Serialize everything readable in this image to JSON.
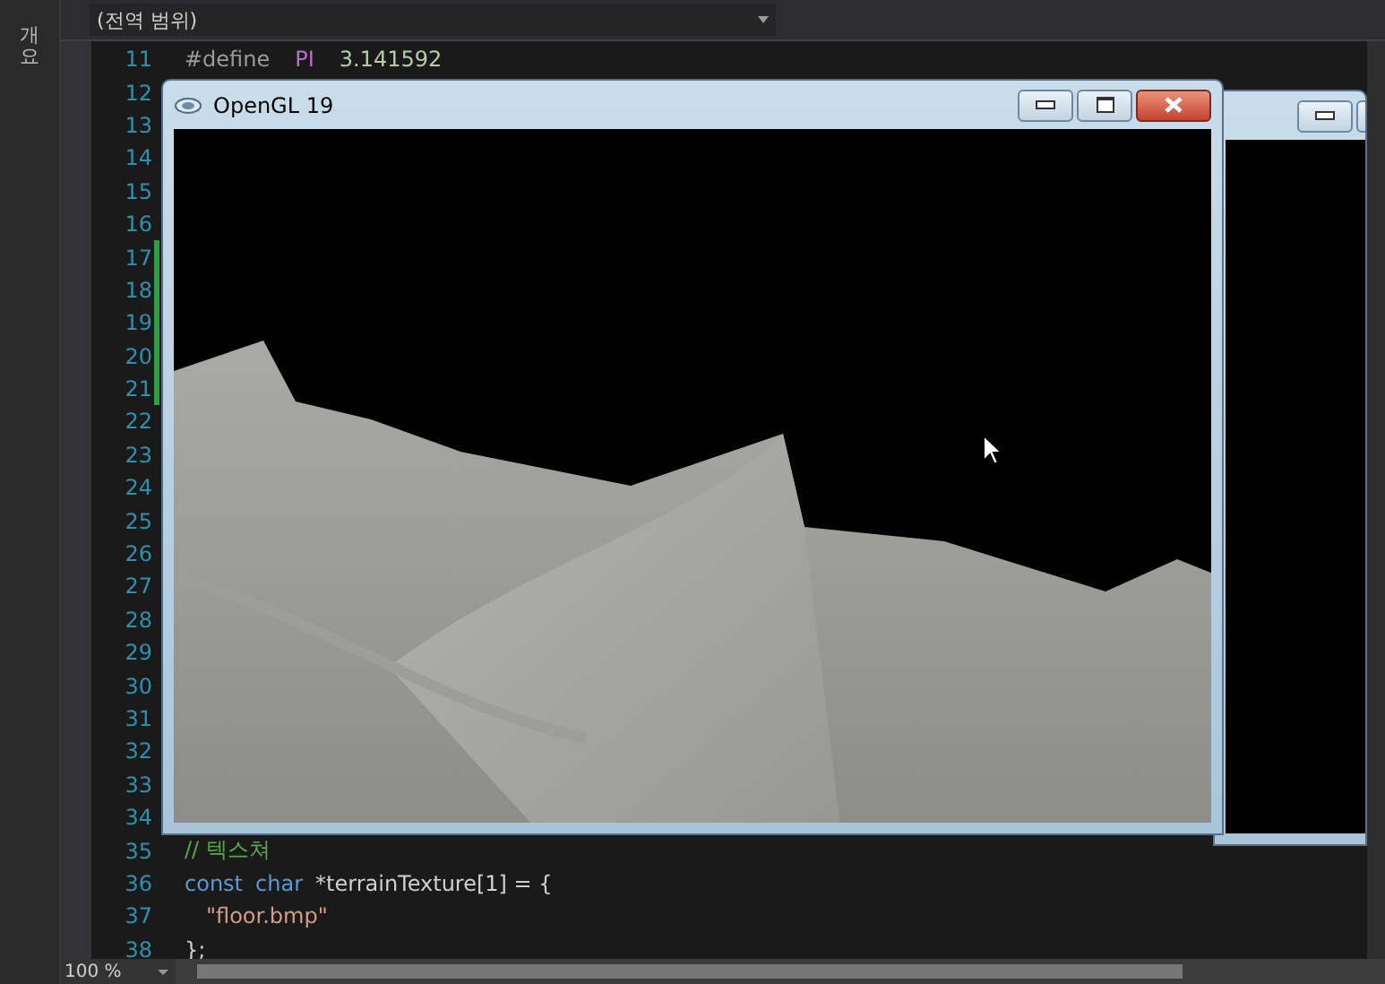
{
  "side_tab": {
    "label": "개요"
  },
  "scope_dropdown": {
    "value": "(전역 범위)"
  },
  "lines": [
    {
      "number": "11",
      "changed": false,
      "tokens": [
        {
          "kind": "directive",
          "text": "#define"
        },
        {
          "kind": "macro",
          "text": "PI"
        },
        {
          "kind": "number",
          "text": "3.141592"
        }
      ]
    },
    {
      "number": "12",
      "changed": false
    },
    {
      "number": "13",
      "changed": false
    },
    {
      "number": "14",
      "changed": false
    },
    {
      "number": "15",
      "changed": false
    },
    {
      "number": "16",
      "changed": false
    },
    {
      "number": "17",
      "changed": true
    },
    {
      "number": "18",
      "changed": true
    },
    {
      "number": "19",
      "changed": true
    },
    {
      "number": "20",
      "changed": true
    },
    {
      "number": "21",
      "changed": true
    },
    {
      "number": "22",
      "changed": false
    },
    {
      "number": "23",
      "changed": false
    },
    {
      "number": "24",
      "changed": false
    },
    {
      "number": "25",
      "changed": false
    },
    {
      "number": "26",
      "changed": false
    },
    {
      "number": "27",
      "changed": false
    },
    {
      "number": "28",
      "changed": false
    },
    {
      "number": "29",
      "changed": false
    },
    {
      "number": "30",
      "changed": false
    },
    {
      "number": "31",
      "changed": false
    },
    {
      "number": "32",
      "changed": false
    },
    {
      "number": "33",
      "changed": false
    },
    {
      "number": "34",
      "changed": false
    },
    {
      "number": "35",
      "changed": false,
      "tokens": [
        {
          "kind": "comment",
          "text": "// 텍스쳐"
        }
      ]
    },
    {
      "number": "36",
      "changed": false,
      "tokens": [
        {
          "kind": "keyword",
          "text": "const"
        },
        {
          "kind": "keyword",
          "text": "char"
        },
        {
          "kind": "plain",
          "text": "*terrainTexture[1] = {"
        }
      ]
    },
    {
      "number": "37",
      "changed": false,
      "indent": true,
      "tokens": [
        {
          "kind": "string",
          "text": "\"floor.bmp\""
        }
      ]
    },
    {
      "number": "38",
      "changed": false,
      "tokens": [
        {
          "kind": "plain",
          "text": "};"
        }
      ]
    }
  ],
  "zoom": {
    "value": "100 %"
  },
  "gl_window": {
    "title": "OpenGL 19"
  }
}
